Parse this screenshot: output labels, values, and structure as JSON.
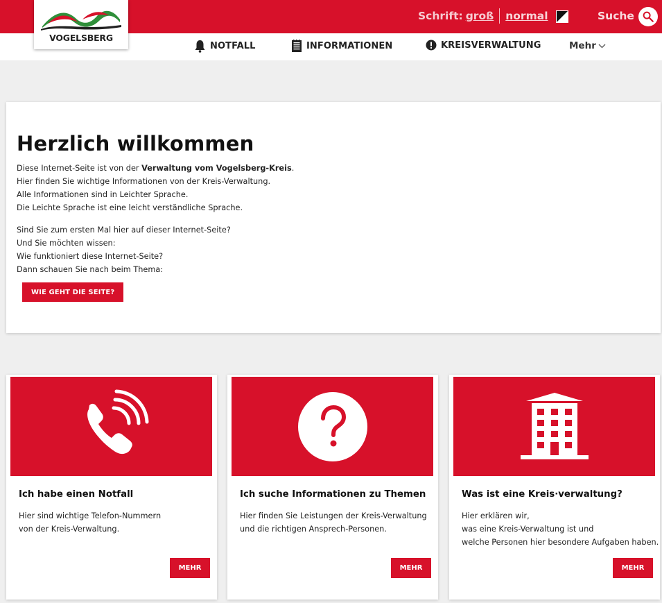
{
  "header": {
    "logo_text": "VOGELSBERG",
    "font_size": {
      "label": "Schrift:",
      "large": "groß",
      "normal": "normal"
    },
    "contrast_icon": "contrast-icon",
    "search_label": "Suche",
    "search_icon": "search-icon",
    "accent_color": "#d7112a"
  },
  "nav": {
    "items": [
      {
        "label": "NOTFALL",
        "icon": "bell-icon"
      },
      {
        "label": "INFORMATIONEN",
        "icon": "document-icon"
      },
      {
        "label": "KREISVERWALTUNG",
        "icon": "exclamation-icon"
      }
    ],
    "more": "Mehr"
  },
  "welcome": {
    "title": "Herzlich willkommen",
    "intro_before": "Diese Internet-Seite ist von der ",
    "intro_bold": "Verwaltung vom Vogelsberg-Kreis",
    "intro_after": ".",
    "lines1": [
      "Hier finden Sie wichtige Informationen von der Kreis-Verwaltung.",
      "Alle Informationen sind in Leichter Sprache.",
      "Die Leichte Sprache ist eine leicht verständliche Sprache."
    ],
    "lines2": [
      "Sind Sie zum ersten Mal hier auf dieser Internet-Seite?",
      "Und Sie möchten wissen:",
      "Wie funktioniert diese Internet-Seite?",
      "Dann schauen Sie nach beim Thema:"
    ],
    "button": "WIE GEHT DIE SEITE?"
  },
  "cards": [
    {
      "icon": "phone-icon",
      "title": "Ich habe einen Notfall",
      "lines": [
        "Hier sind wichtige Telefon-Nummern",
        "von der Kreis-Verwaltung."
      ],
      "button": "MEHR"
    },
    {
      "icon": "question-icon",
      "title": "Ich suche Informationen zu Themen",
      "lines": [
        "Hier finden Sie Leistungen der Kreis-Verwaltung",
        "und die richtigen Ansprech-Personen."
      ],
      "button": "MEHR"
    },
    {
      "icon": "building-icon",
      "title": "Was ist eine Kreis·verwaltung?",
      "lines": [
        "Hier erklären wir,",
        "was eine Kreis-Verwaltung ist und",
        "welche Personen hier besondere Aufgaben haben."
      ],
      "button": "MEHR"
    }
  ]
}
